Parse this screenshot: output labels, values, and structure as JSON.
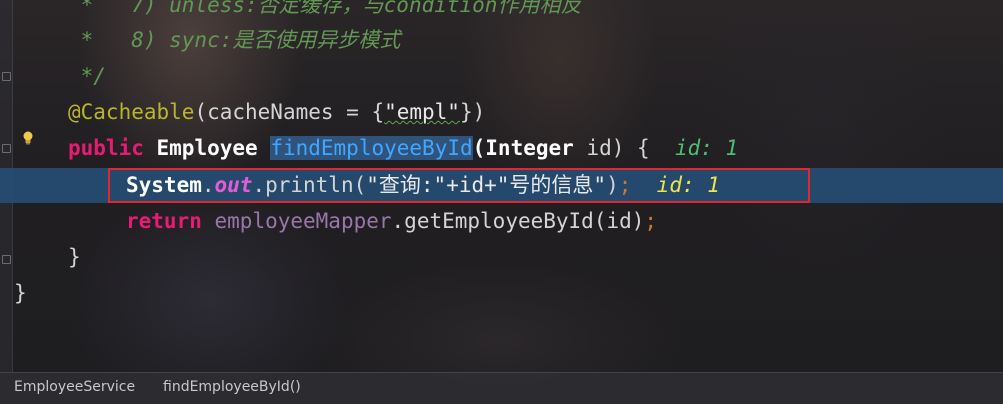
{
  "code": {
    "comment_line1_prefix": " *   7) unless:",
    "comment_line1_rest": "否定缓存，与condition作用相反",
    "comment_line2": " *   8) sync:是否使用异步模式",
    "comment_close": " */",
    "annotation": "@Cacheable",
    "annotation_args_open": "(cacheNames = {",
    "annotation_value": "\"empl\"",
    "annotation_args_close": "})",
    "method_kw": "public",
    "return_type": "Employee",
    "method_name": "findEmployeeById",
    "param_open": "(",
    "param_type": "Integer",
    "param_rest": " id) {",
    "hint_method": "id: 1",
    "print_class": "System",
    "print_dot1": ".",
    "print_field": "out",
    "print_call": ".println(",
    "print_str1": "\"查询:\"",
    "print_concat": "+id+",
    "print_str2": "\"号的信息\"",
    "print_close": ")",
    "print_semi": ";",
    "hint_print": "id: 1",
    "return_kw": "return",
    "mapper_field": "employeeMapper",
    "mapper_call": ".getEmployeeById(id)",
    "return_semi": ";",
    "close_method": "}",
    "close_class": "}"
  },
  "statusbar": {
    "class_name": "EmployeeService",
    "method_name": "findEmployeeById()"
  }
}
